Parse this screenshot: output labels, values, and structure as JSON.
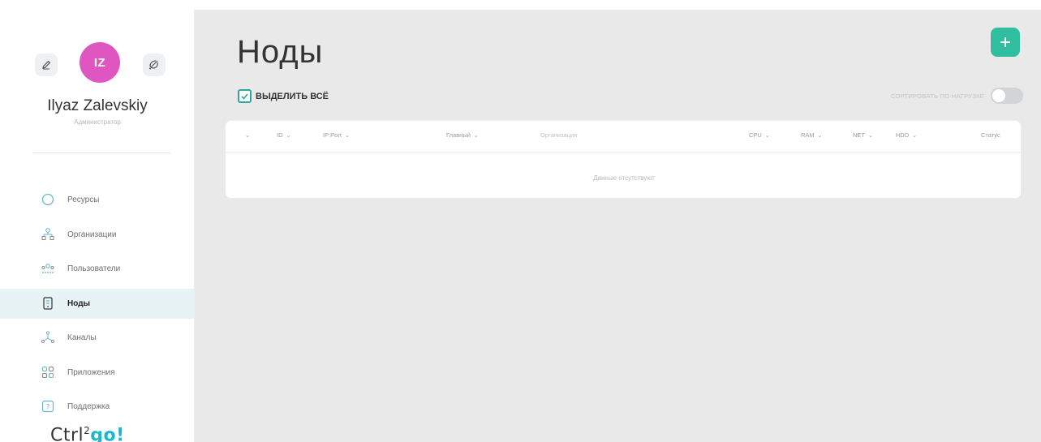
{
  "sidebar": {
    "avatar_initials": "IZ",
    "user_name": "Ilyaz Zalevskiy",
    "user_role": "Администратор",
    "nav": [
      {
        "label": "Ресурсы",
        "icon": "resources-icon"
      },
      {
        "label": "Организации",
        "icon": "organizations-icon"
      },
      {
        "label": "Пользователи",
        "icon": "users-icon"
      },
      {
        "label": "Ноды",
        "icon": "nodes-icon",
        "active": true
      },
      {
        "label": "Каналы",
        "icon": "channels-icon"
      },
      {
        "label": "Приложения",
        "icon": "apps-icon"
      },
      {
        "label": "Поддержка",
        "icon": "support-icon"
      }
    ],
    "logo": {
      "part1": "Ctrl",
      "sup": "2",
      "part2": "go!"
    }
  },
  "main": {
    "title": "Ноды",
    "add_symbol": "+",
    "select_all_label": "ВЫДЕЛИТЬ ВСЁ",
    "sort_by_load_label": "СОРТИРОВАТЬ ПО НАГРУЗКЕ",
    "sort_by_load_on": false,
    "table": {
      "columns": [
        "ID",
        "IP:Port",
        "Главный",
        "Организация",
        "CPU",
        "RAM",
        "NET",
        "HDD",
        "Статус"
      ],
      "sort_arrow": "⌄",
      "empty_text": "Данные отсутствуют"
    }
  },
  "colors": {
    "accent": "#2fbfa0",
    "avatar": "#e056c0",
    "active_nav_bg": "#e8f3f5",
    "logo_go": "#19b7c9"
  }
}
